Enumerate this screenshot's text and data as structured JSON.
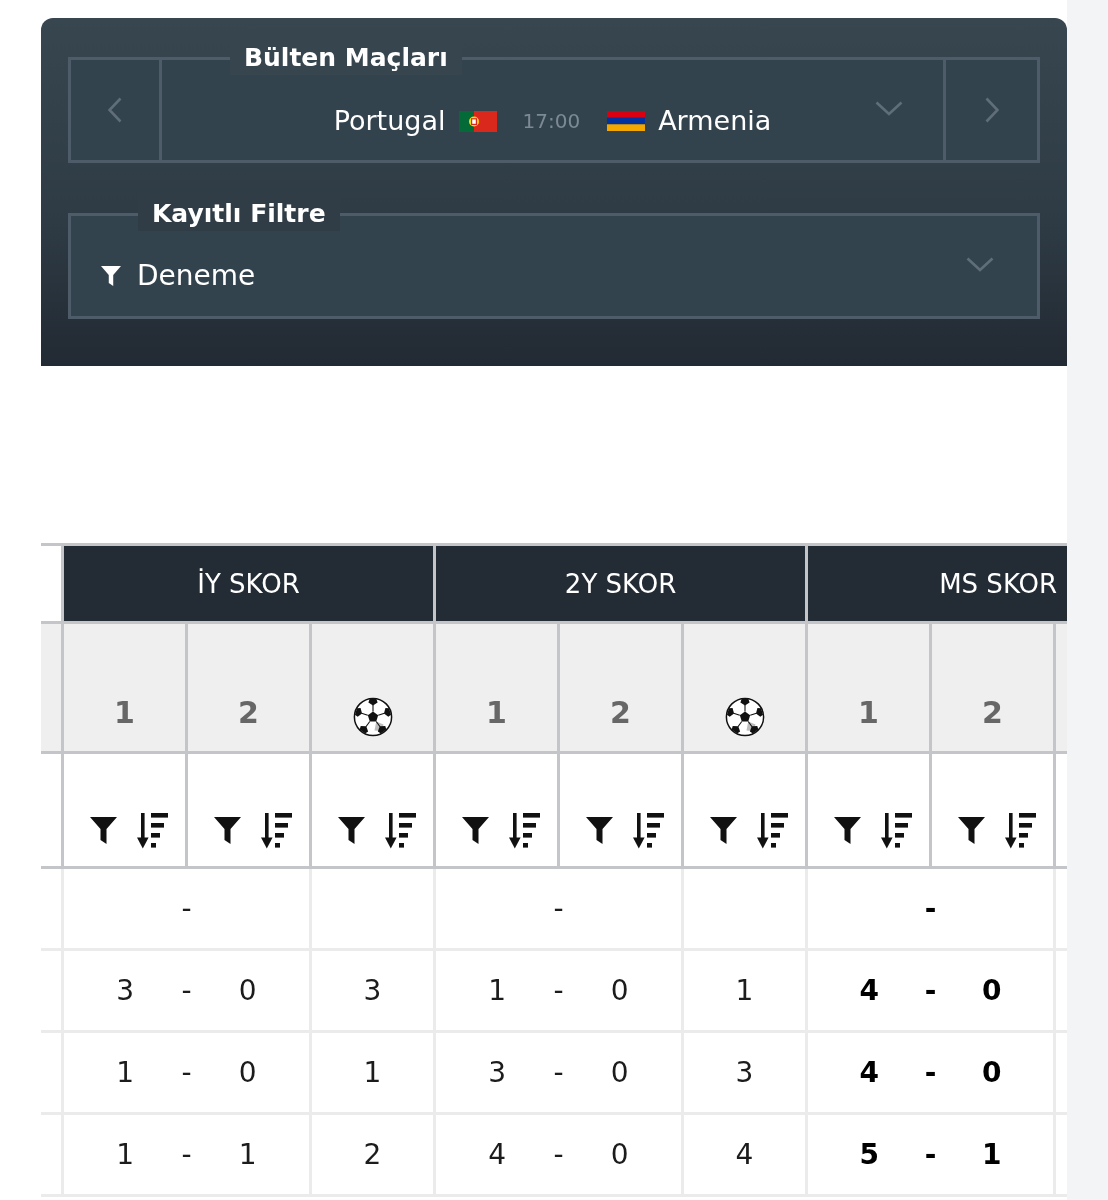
{
  "bulletin_panel": {
    "match_selector": {
      "legend": "Bülten Maçları",
      "home_team": "Portugal",
      "time": "17:00",
      "away_team": "Armenia"
    },
    "saved_filter": {
      "legend": "Kayıtlı Filtre",
      "value": "Deneme"
    }
  },
  "table": {
    "groups": [
      {
        "label": "İY SKOR",
        "emphasized": false,
        "columns": [
          {
            "kind": "number",
            "label": "1"
          },
          {
            "kind": "number",
            "label": "2"
          },
          {
            "kind": "ball"
          }
        ]
      },
      {
        "label": "2Y SKOR",
        "emphasized": false,
        "columns": [
          {
            "kind": "number",
            "label": "1"
          },
          {
            "kind": "number",
            "label": "2"
          },
          {
            "kind": "ball"
          }
        ]
      },
      {
        "label": "MS SKOR",
        "emphasized": true,
        "columns": [
          {
            "kind": "number",
            "label": "1"
          },
          {
            "kind": "number",
            "label": "2"
          },
          {
            "kind": "cut"
          }
        ]
      }
    ],
    "rows": [
      {
        "cells": [
          {
            "separator": "-"
          },
          {
            "separator": "-"
          },
          {
            "separator": "-"
          }
        ]
      },
      {
        "cells": [
          {
            "home": "3",
            "separator": "-",
            "away": "0",
            "goals": "3"
          },
          {
            "home": "1",
            "separator": "-",
            "away": "0",
            "goals": "1"
          },
          {
            "home": "4",
            "separator": "-",
            "away": "0"
          }
        ]
      },
      {
        "cells": [
          {
            "home": "1",
            "separator": "-",
            "away": "0",
            "goals": "1"
          },
          {
            "home": "3",
            "separator": "-",
            "away": "0",
            "goals": "3"
          },
          {
            "home": "4",
            "separator": "-",
            "away": "0"
          }
        ]
      },
      {
        "cells": [
          {
            "home": "1",
            "separator": "-",
            "away": "1",
            "goals": "2"
          },
          {
            "home": "4",
            "separator": "-",
            "away": "0",
            "goals": "4"
          },
          {
            "home": "5",
            "separator": "-",
            "away": "1"
          }
        ]
      }
    ]
  }
}
